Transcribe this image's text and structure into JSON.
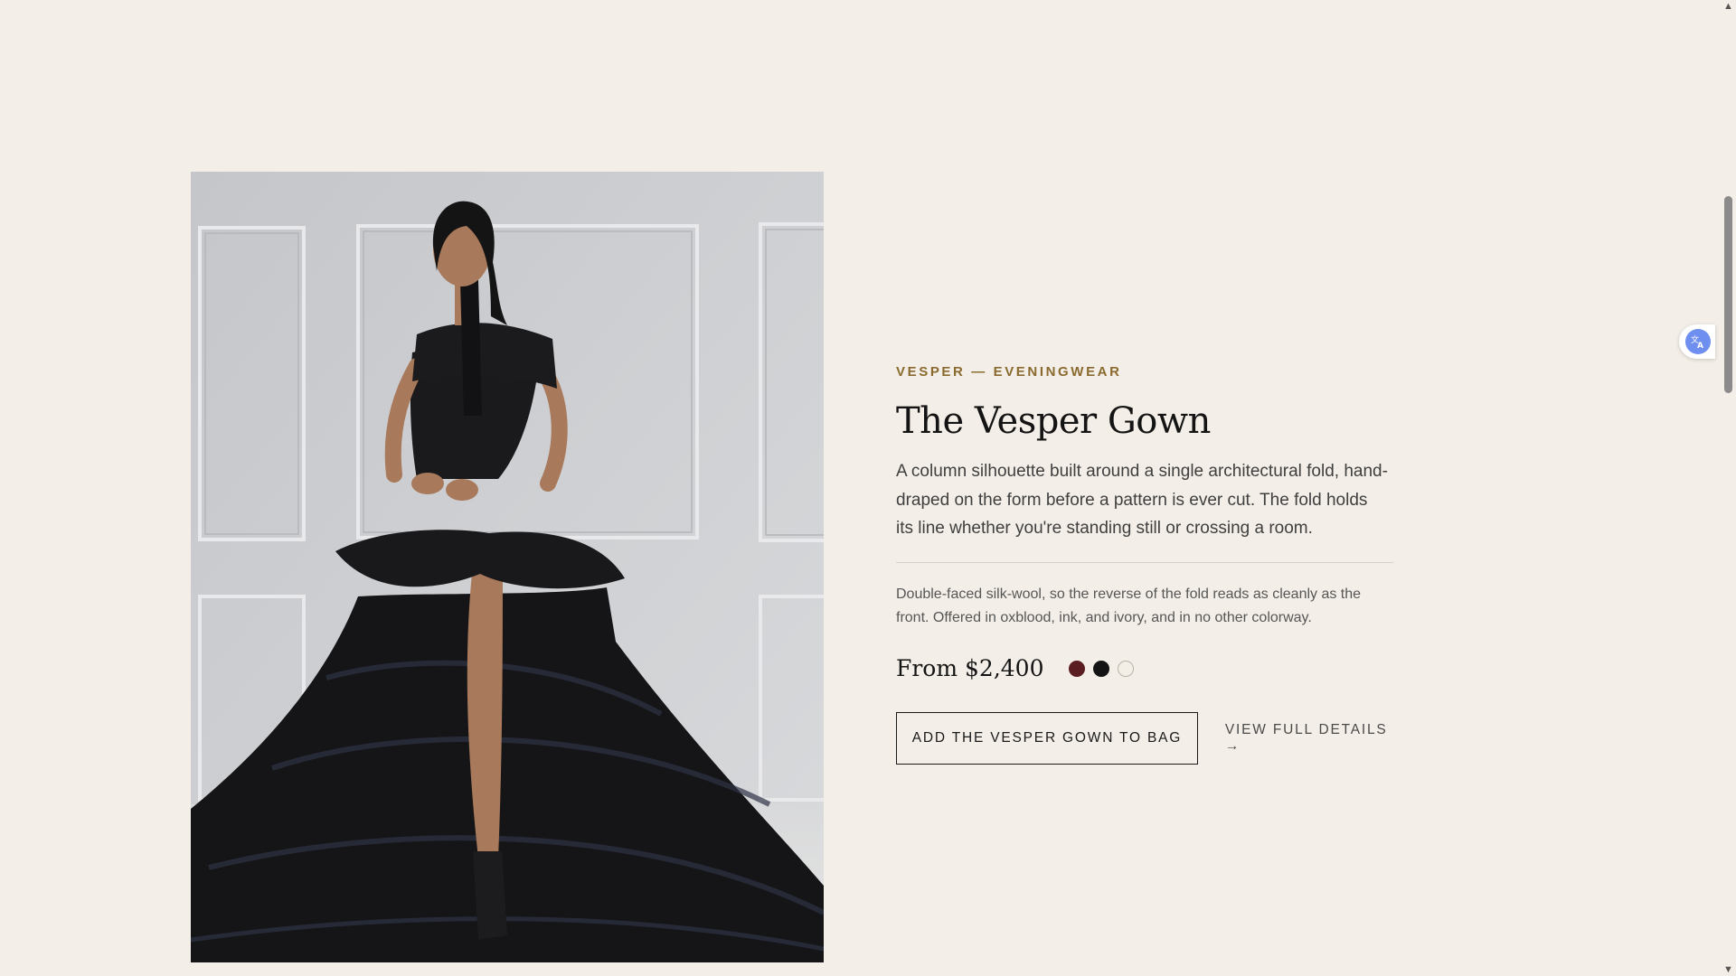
{
  "product": {
    "eyebrow": "VESPER — EVENINGWEAR",
    "title": "The Vesper Gown",
    "lede": "A column silhouette built around a single architectural fold, hand-draped on the form before a pattern is ever cut. The fold holds its line whether you're standing still or crossing a room.",
    "detail": "Double-faced silk-wool, so the reverse of the fold reads as cleanly as the front. Offered in oxblood, ink, and ivory, and in no other colorway.",
    "price": "From $2,400",
    "swatches": [
      {
        "name": "oxblood",
        "color": "#5a1e22"
      },
      {
        "name": "ink",
        "color": "#141414"
      },
      {
        "name": "ivory",
        "color": "#f4efe6"
      }
    ],
    "add_to_bag_label": "ADD THE VESPER GOWN TO BAG",
    "view_details_label": "VIEW FULL DETAILS →"
  },
  "colors": {
    "page_background": "#f3eee7",
    "eyebrow_accent": "#8a6a2f",
    "text": "#1a1a1a"
  },
  "icons": {
    "translate": "translate-icon",
    "scroll_up": "scroll-up-arrow-icon",
    "scroll_down": "scroll-down-arrow-icon"
  }
}
